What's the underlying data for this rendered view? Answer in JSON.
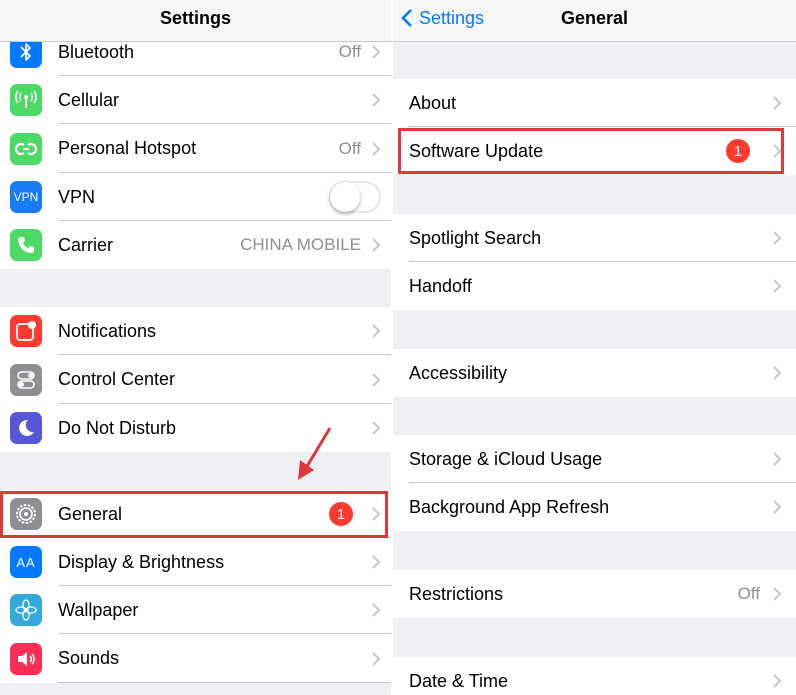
{
  "left": {
    "title": "Settings",
    "rows": [
      {
        "label": "Bluetooth",
        "value": "Off",
        "icon": "bluetooth-icon"
      },
      {
        "label": "Cellular",
        "value": "",
        "icon": "cellular-icon"
      },
      {
        "label": "Personal Hotspot",
        "value": "Off",
        "icon": "hotspot-icon"
      },
      {
        "label": "VPN",
        "value": "",
        "icon": "vpn-icon",
        "icon_text": "VPN",
        "toggle": "off"
      },
      {
        "label": "Carrier",
        "value": "CHINA MOBILE",
        "icon": "phone-icon"
      },
      {
        "label": "Notifications",
        "value": "",
        "icon": "notifications-icon"
      },
      {
        "label": "Control Center",
        "value": "",
        "icon": "control-center-icon"
      },
      {
        "label": "Do Not Disturb",
        "value": "",
        "icon": "moon-icon"
      },
      {
        "label": "General",
        "value": "",
        "icon": "gear-icon",
        "badge": "1"
      },
      {
        "label": "Display & Brightness",
        "value": "",
        "icon": "display-icon",
        "icon_text": "AA"
      },
      {
        "label": "Wallpaper",
        "value": "",
        "icon": "wallpaper-icon"
      },
      {
        "label": "Sounds",
        "value": "",
        "icon": "speaker-icon"
      }
    ]
  },
  "right": {
    "back_label": "Settings",
    "title": "General",
    "rows": [
      {
        "label": "About",
        "value": ""
      },
      {
        "label": "Software Update",
        "value": "",
        "badge": "1"
      },
      {
        "label": "Spotlight Search",
        "value": ""
      },
      {
        "label": "Handoff",
        "value": ""
      },
      {
        "label": "Accessibility",
        "value": ""
      },
      {
        "label": "Storage & iCloud Usage",
        "value": ""
      },
      {
        "label": "Background App Refresh",
        "value": ""
      },
      {
        "label": "Restrictions",
        "value": "Off"
      },
      {
        "label": "Date & Time",
        "value": ""
      }
    ]
  },
  "colors": {
    "accent": "#007aff",
    "highlight": "#e0373a",
    "badge": "#ff3b30",
    "group_background": "#efeff4"
  }
}
